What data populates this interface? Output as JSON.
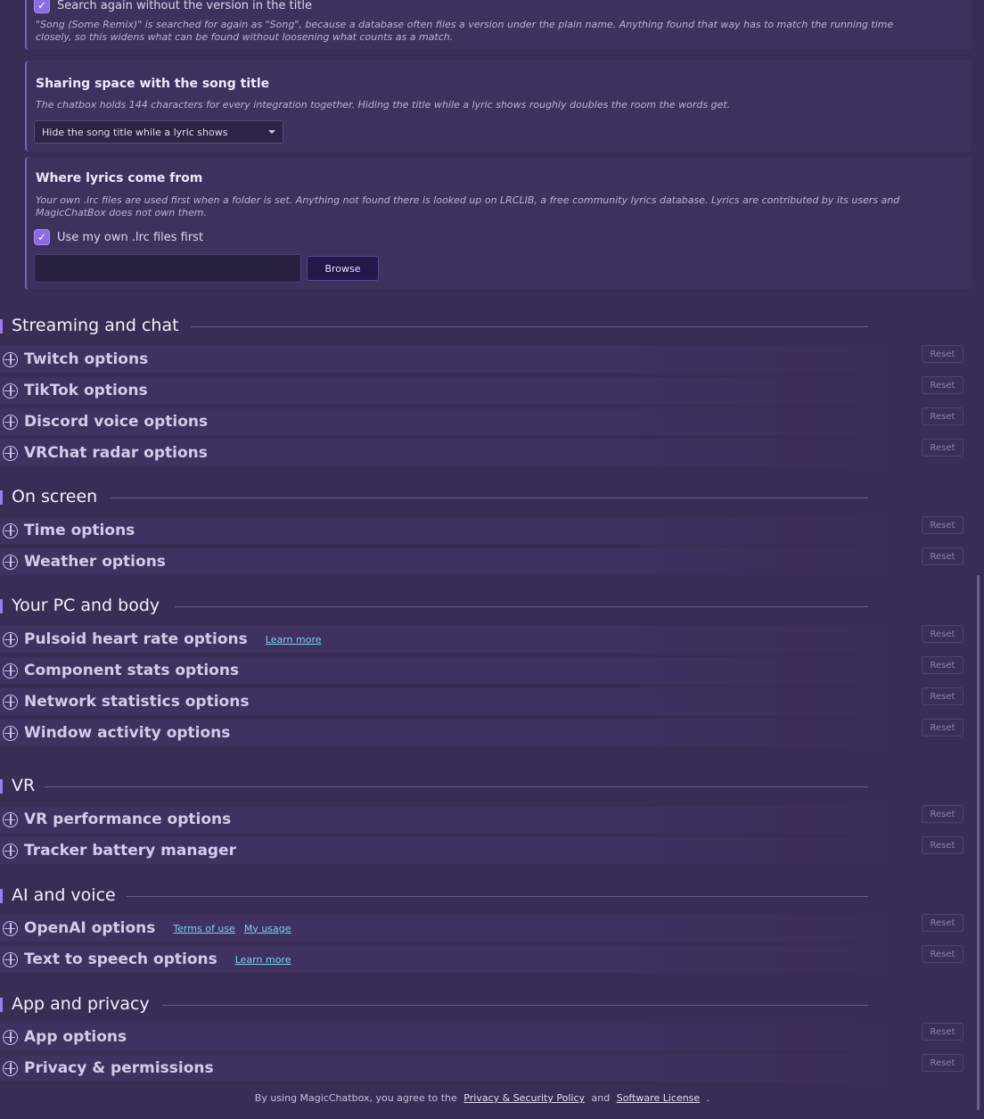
{
  "lyrics_panel": {
    "search_again": {
      "label": "Search again without the version in the title",
      "checked": true,
      "description": "\"Song (Some Remix)\" is searched for again as \"Song\", because a database often files a version under the plain name. Anything found that way has to match the running time closely, so this widens what can be found without loosening what counts as a match."
    },
    "sharing": {
      "title": "Sharing space with the song title",
      "description": "The chatbox holds 144 characters for every integration together. Hiding the title while a lyric shows roughly doubles the room the words get.",
      "selected_option": "Hide the song title while a lyric shows"
    },
    "source": {
      "title": "Where lyrics come from",
      "description": "Your own .lrc files are used first when a folder is set. Anything not found there is looked up on LRCLIB, a free community lyrics database. Lyrics are contributed by its users and MagicChatBox does not own them.",
      "checkbox_label": "Use my own .lrc files first",
      "checked": true,
      "folder_value": "",
      "browse_label": "Browse"
    }
  },
  "reset_label": "Reset",
  "sections": [
    {
      "title": "Streaming and chat",
      "items": [
        {
          "title": "Twitch options",
          "links": []
        },
        {
          "title": "TikTok options",
          "links": []
        },
        {
          "title": "Discord voice options",
          "links": []
        },
        {
          "title": "VRChat radar options",
          "links": []
        }
      ]
    },
    {
      "title": "On screen",
      "items": [
        {
          "title": "Time options",
          "links": []
        },
        {
          "title": "Weather options",
          "links": []
        }
      ]
    },
    {
      "title": "Your PC and body",
      "items": [
        {
          "title": "Pulsoid heart rate options",
          "links": [
            "Learn more"
          ]
        },
        {
          "title": "Component stats options",
          "links": []
        },
        {
          "title": "Network statistics options",
          "links": []
        },
        {
          "title": "Window activity options",
          "links": []
        }
      ]
    },
    {
      "title": "VR",
      "items": [
        {
          "title": "VR performance options",
          "links": []
        },
        {
          "title": "Tracker battery manager",
          "links": []
        }
      ]
    },
    {
      "title": "AI and voice",
      "items": [
        {
          "title": "OpenAI options",
          "links": [
            "Terms of use",
            "My usage"
          ]
        },
        {
          "title": "Text to speech options",
          "links": [
            "Learn more"
          ]
        }
      ]
    },
    {
      "title": "App and privacy",
      "items": [
        {
          "title": "App options",
          "links": []
        },
        {
          "title": "Privacy & permissions",
          "links": []
        }
      ]
    }
  ],
  "footer": {
    "prefix": "By using MagicChatbox, you agree to the",
    "privacy_link": "Privacy & Security Policy",
    "and": "and",
    "license_link": "Software License",
    "suffix": "."
  },
  "colors": {
    "background": "#3a2d55",
    "accent": "#9b7cf2",
    "link": "#7ad3e6"
  }
}
